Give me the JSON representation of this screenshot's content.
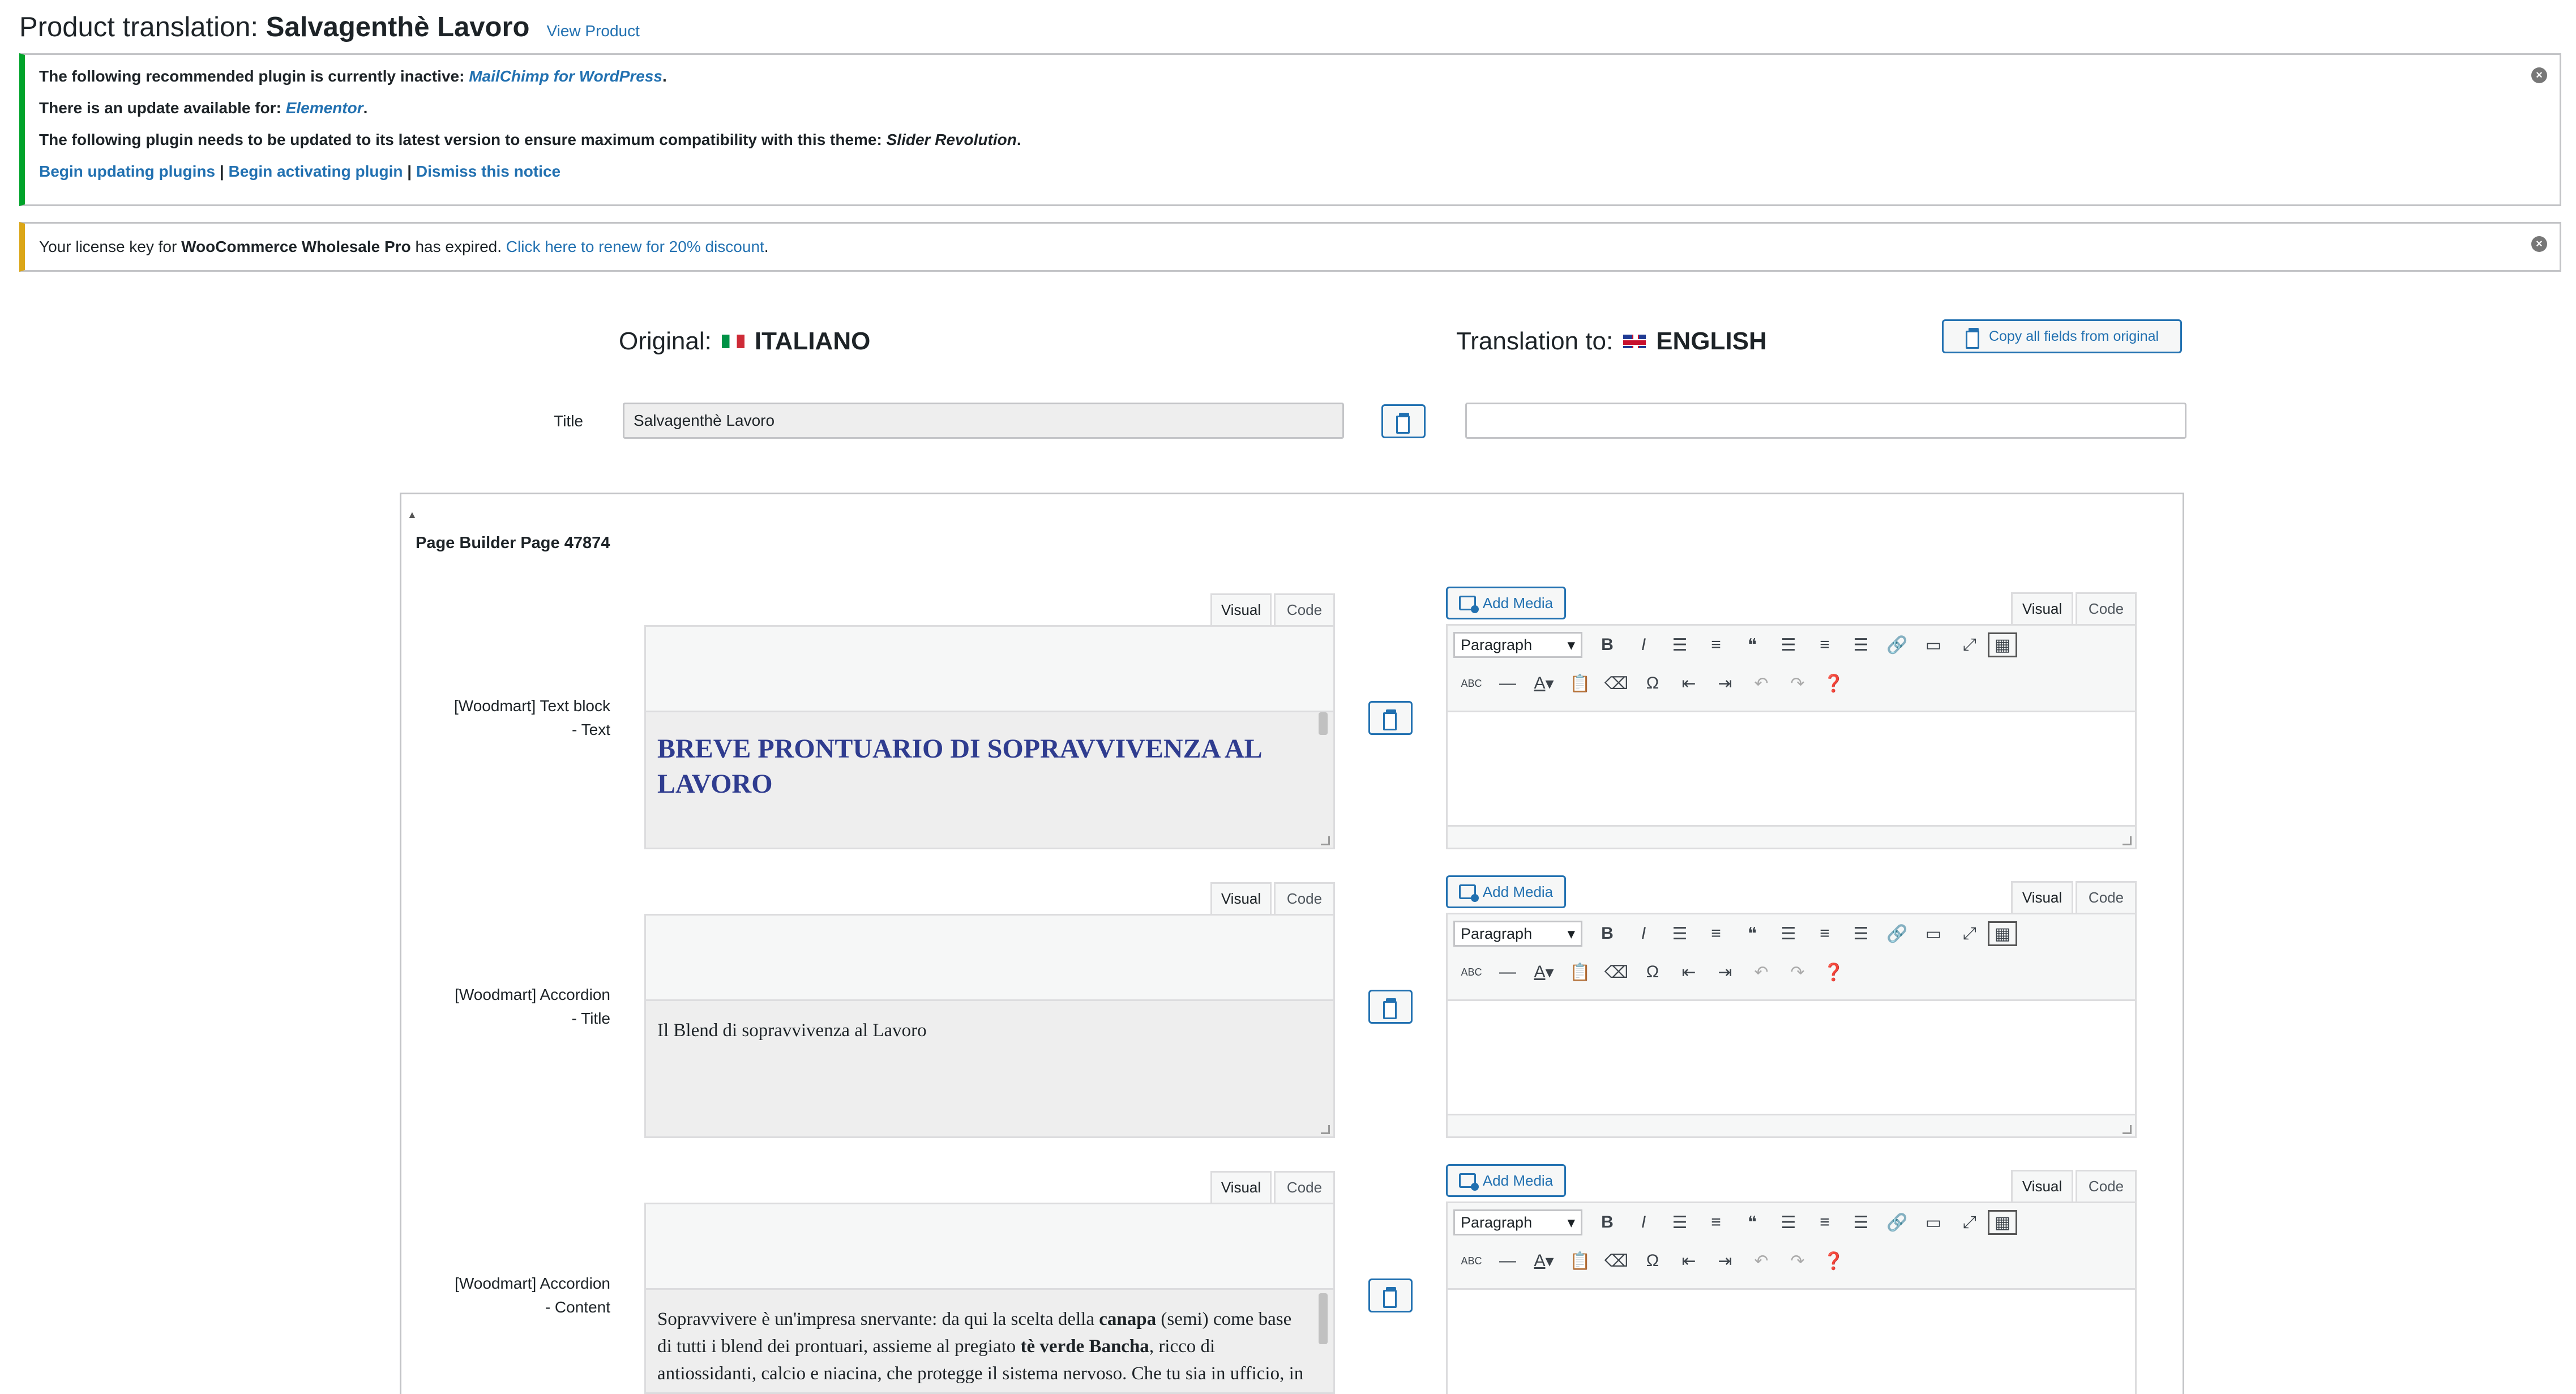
{
  "header": {
    "title_prefix": "Product translation:",
    "title_product": "Salvagenthè Lavoro",
    "view_link": "View Product"
  },
  "notice_plugins": {
    "line1_text": "The following recommended plugin is currently inactive:",
    "line1_plugin": "MailChimp for WordPress",
    "line2_text": "There is an update available for:",
    "line2_plugin": "Elementor",
    "line3_text": "The following plugin needs to be updated to its latest version to ensure maximum compatibility with this theme:",
    "line3_plugin": "Slider Revolution",
    "link_update": "Begin updating plugins",
    "link_activate": "Begin activating plugin",
    "link_dismiss": "Dismiss this notice",
    "separator": "|",
    "accent_color": "#00a32a"
  },
  "notice_license": {
    "text_before": "Your license key for",
    "product": "WooCommerce Wholesale Pro",
    "text_after": "has expired.",
    "link": "Click here to renew for 20% discount",
    "accent_color": "#dba617"
  },
  "original": {
    "label": "Original:",
    "language": "ITALIANO",
    "flag": "flag-it"
  },
  "translation": {
    "label": "Translation to:",
    "language": "ENGLISH",
    "flag": "flag-gb"
  },
  "copy_all_label": "Copy all fields from original",
  "title_row": {
    "label": "Title",
    "original_value": "Salvagenthè Lavoro",
    "translation_value": ""
  },
  "page_builder": {
    "title": "Page Builder Page 47874",
    "toggle_icon": "triangle-up-icon"
  },
  "editor_tabs": {
    "visual": "Visual",
    "code": "Code"
  },
  "add_media_label": "Add Media",
  "format_select": "Paragraph",
  "fields": [
    {
      "label_line1": "[Woodmart] Text block",
      "label_line2": "- Text",
      "original_text": "BREVE PRONTUARIO DI SOPRAVVIVENZA AL LAVORO"
    },
    {
      "label_line1": "[Woodmart] Accordion",
      "label_line2": "- Title",
      "original_text": "Il Blend di sopravvivenza al Lavoro"
    },
    {
      "label_line1": "[Woodmart] Accordion",
      "label_line2": "- Content",
      "content_a": "Sopravvivere è un'impresa snervante: da qui la scelta della",
      "content_b": "canapa",
      "content_c": "(semi) come base di tutti i blend dei prontuari, assieme al pregiato",
      "content_d": "tè verde Bancha",
      "content_e": ", ricco di antiossidanti, calcio e niacina, che protegge il sistema nervoso. Che tu sia in ufficio, in smart working o in meditazione orizzontale, questo blend ti sostiene."
    }
  ],
  "link_color": "#2271b1"
}
